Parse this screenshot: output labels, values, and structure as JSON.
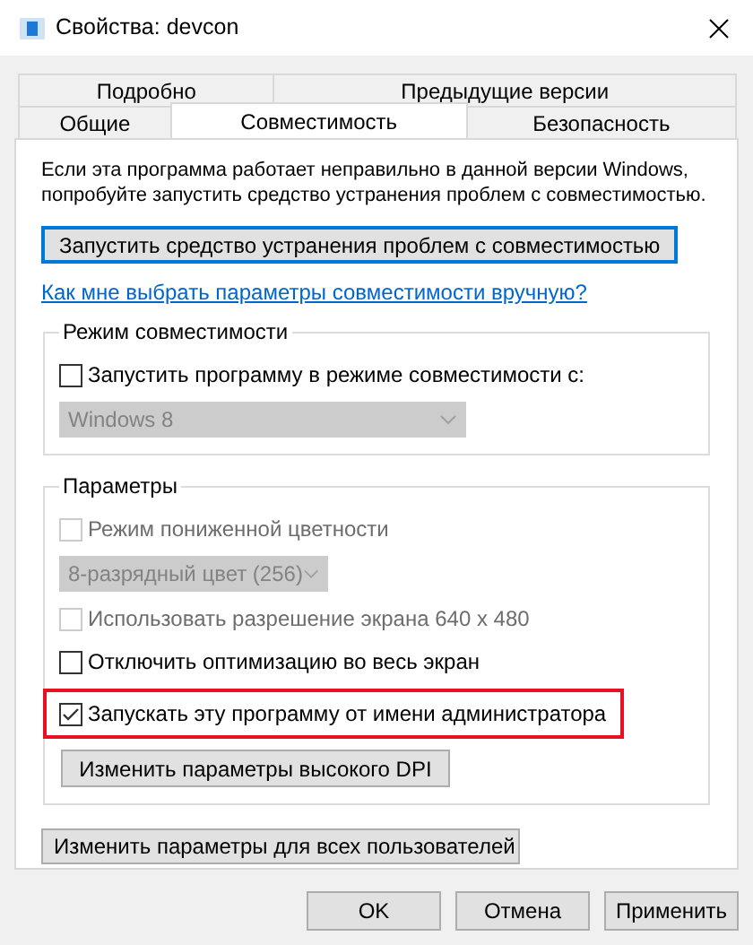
{
  "window": {
    "title": "Свойства: devcon"
  },
  "tabs": [
    [
      {
        "label": "Подробно",
        "selected": false
      },
      {
        "label": "Предыдущие версии",
        "selected": false
      }
    ],
    [
      {
        "label": "Общие",
        "selected": false
      },
      {
        "label": "Совместимость",
        "selected": true
      },
      {
        "label": "Безопасность",
        "selected": false
      }
    ]
  ],
  "intro": "Если эта программа работает неправильно в данной версии Windows, попробуйте запустить средство устранения проблем с совместимостью.",
  "troubleshoot_button": {
    "label": "Запустить средство устранения проблем с совместимостью",
    "focused": true
  },
  "help_link": "Как мне выбрать параметры совместимости вручную?",
  "groups": [
    {
      "title": "Режим совместимости",
      "items": [
        {
          "kind": "checkbox",
          "label": "Запустить программу в режиме совместимости с:",
          "checked": false,
          "disabled": false,
          "highlighted": false
        },
        {
          "kind": "dropdown",
          "value": "Windows 8",
          "disabled": true,
          "wide": true
        }
      ]
    },
    {
      "title": "Параметры",
      "items": [
        {
          "kind": "checkbox",
          "label": "Режим пониженной цветности",
          "checked": false,
          "disabled": true,
          "highlighted": false
        },
        {
          "kind": "dropdown",
          "value": "8-разрядный цвет (256)",
          "disabled": true,
          "wide": false
        },
        {
          "kind": "checkbox",
          "label": "Использовать разрешение экрана 640 x 480",
          "checked": false,
          "disabled": true,
          "highlighted": false
        },
        {
          "kind": "checkbox",
          "label": "Отключить оптимизацию во весь экран",
          "checked": false,
          "disabled": false,
          "highlighted": false
        },
        {
          "kind": "checkbox",
          "label": "Запускать эту программу от имени администратора",
          "checked": true,
          "disabled": false,
          "highlighted": true
        },
        {
          "kind": "button",
          "label": "Изменить параметры высокого DPI"
        }
      ]
    }
  ],
  "all_users_button": "Изменить параметры для всех пользователей",
  "buttons": [
    "OK",
    "Отмена",
    "Применить"
  ]
}
